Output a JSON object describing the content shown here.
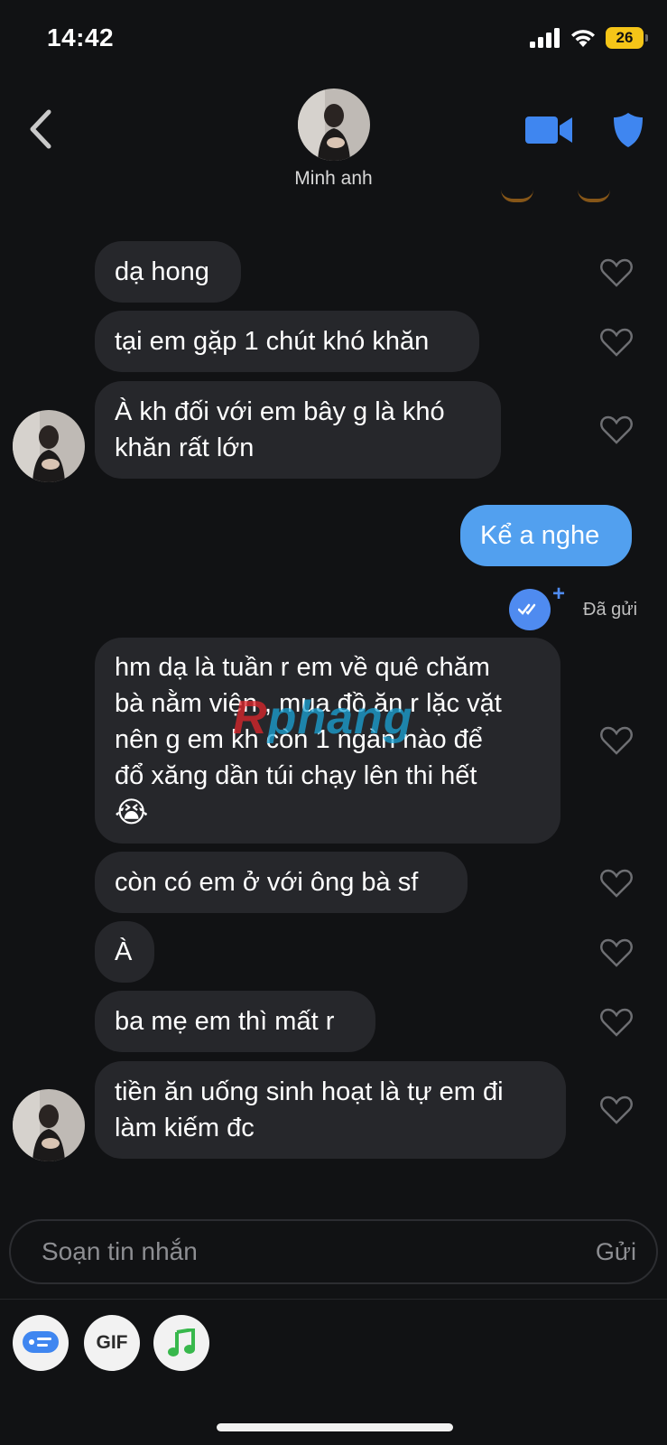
{
  "status_bar": {
    "time": "14:42",
    "battery": "26"
  },
  "header": {
    "contact_name": "Minh anh"
  },
  "messages": [
    {
      "id": "m1",
      "direction": "incoming",
      "text": "dạ hong"
    },
    {
      "id": "m2",
      "direction": "incoming",
      "text": "tại em gặp 1 chút khó khăn"
    },
    {
      "id": "m3",
      "direction": "incoming",
      "lines": [
        "À kh đối với em bây g là khó",
        "khăn rất lớn"
      ]
    },
    {
      "id": "m4",
      "direction": "outgoing",
      "text": "Kể a nghe",
      "status": "Đã gửi"
    },
    {
      "id": "m5",
      "direction": "incoming",
      "lines": [
        "hm dạ là tuần r em về quê chăm",
        "bà nằm viện , mua đồ ăn r lặc vặt",
        "nên g em kh còn 1 ngàn nào để",
        "đổ xăng dần túi chạy lên thi hết"
      ],
      "emoji": "😭"
    },
    {
      "id": "m6",
      "direction": "incoming",
      "text": "còn có em ở với ông bà sf"
    },
    {
      "id": "m7",
      "direction": "incoming",
      "text": "À"
    },
    {
      "id": "m8",
      "direction": "incoming",
      "text": "ba mẹ em thì mất r"
    },
    {
      "id": "m9",
      "direction": "incoming",
      "lines": [
        "tiền ăn uống sinh hoạt là tự em đi",
        "làm kiếm đc"
      ]
    }
  ],
  "watermark": {
    "prefix": "R",
    "text": "phang"
  },
  "composer": {
    "placeholder": "Soạn tin nhắn",
    "send_label": "Gửi"
  },
  "toolbar": {
    "gif_label": "GIF"
  },
  "colors": {
    "background": "#111214",
    "incoming_bubble": "#26272b",
    "outgoing_bubble": "#52a0ef",
    "accent": "#4f8bf0"
  }
}
